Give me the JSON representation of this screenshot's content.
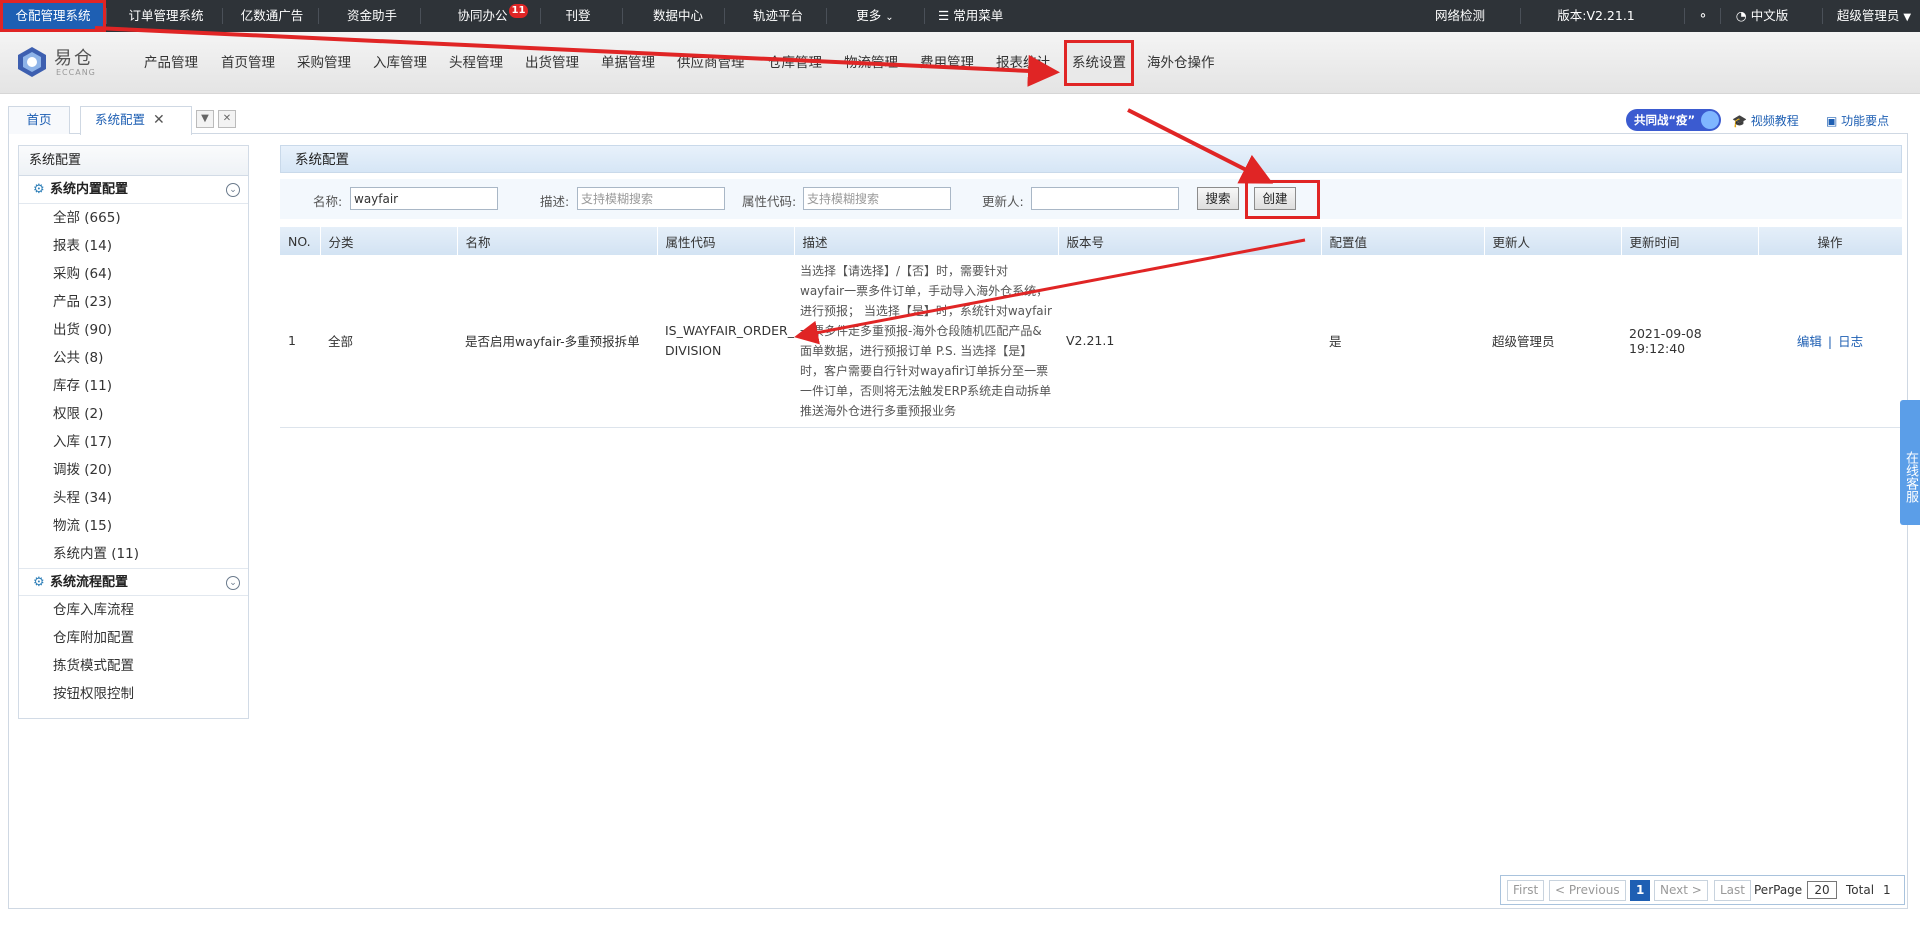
{
  "topbar": {
    "items": [
      "仓配管理系统",
      "订单管理系统",
      "亿数通广告",
      "资金助手",
      "协同办公",
      "刊登",
      "数据中心",
      "轨迹平台",
      "更多"
    ],
    "badge": "11",
    "common_menu": "常用菜单",
    "network": "网络检测",
    "version": "版本:V2.21.1 (kaifa)",
    "language": "中文版",
    "user": "超级管理员"
  },
  "logo": {
    "cn": "易仓",
    "en": "ECCANG"
  },
  "nav2": {
    "items": [
      "产品管理",
      "首页管理",
      "采购管理",
      "入库管理",
      "头程管理",
      "出货管理",
      "单据管理",
      "供应商管理",
      "仓库管理",
      "物流管理",
      "费用管理",
      "报表统计",
      "系统设置",
      "海外仓操作"
    ]
  },
  "tabs": {
    "home": "首页",
    "config": "系统配置"
  },
  "right_links": {
    "fight": "共同战“疫”",
    "video": "视频教程",
    "points": "功能要点"
  },
  "sidebar": {
    "title": "系统配置",
    "group1": "系统内置配置",
    "items1": [
      "全部 (665)",
      "报表 (14)",
      "采购 (64)",
      "产品 (23)",
      "出货 (90)",
      "公共 (8)",
      "库存 (11)",
      "权限 (2)",
      "入库 (17)",
      "调拨 (20)",
      "头程 (34)",
      "物流 (15)",
      "系统内置 (11)"
    ],
    "group2": "系统流程配置",
    "items2": [
      "仓库入库流程",
      "仓库附加配置",
      "拣货模式配置",
      "按钮权限控制"
    ]
  },
  "panel": {
    "title": "系统配置"
  },
  "filter": {
    "name_label": "名称:",
    "name_value": "wayfair",
    "desc_label": "描述:",
    "desc_placeholder": "支持模糊搜索",
    "code_label": "属性代码:",
    "code_placeholder": "支持模糊搜索",
    "updater_label": "更新人:",
    "search_btn": "搜索",
    "create_btn": "创建"
  },
  "table": {
    "headers": [
      "NO.",
      "分类",
      "名称",
      "属性代码",
      "描述",
      "版本号",
      "配置值",
      "更新人",
      "更新时间",
      "操作"
    ],
    "row": {
      "no": "1",
      "category": "全部",
      "name": "是否启用wayfair-多重预报拆单",
      "code": "IS_WAYFAIR_ORDER_DIVISION",
      "desc": "当选择【请选择】/【否】时，需要针对wayfair一票多件订单，手动导入海外仓系统，进行预报； 当选择【是】时，系统针对wayfair一票多件走多重预报-海外仓段随机匹配产品&面单数据，进行预报订单 P.S. 当选择【是】时，客户需要自行针对wayafir订单拆分至一票一件订单，否则将无法触发ERP系统走自动拆单推送海外仓进行多重预报业务",
      "version": "V2.21.1",
      "value": "是",
      "updater": "超级管理员",
      "time": "2021-09-08 19:12:40",
      "edit": "编辑",
      "log": "日志"
    }
  },
  "pager": {
    "first": "First",
    "prev": "< Previous",
    "page": "1",
    "next": "Next >",
    "last": "Last",
    "perpage_label": "PerPage",
    "perpage": "20",
    "total_label": "Total",
    "total": "1"
  },
  "online_service": "在线客服",
  "colors": {
    "topbar": "#2e3338",
    "highlight": "#e02525",
    "link": "#1e5fb3"
  }
}
